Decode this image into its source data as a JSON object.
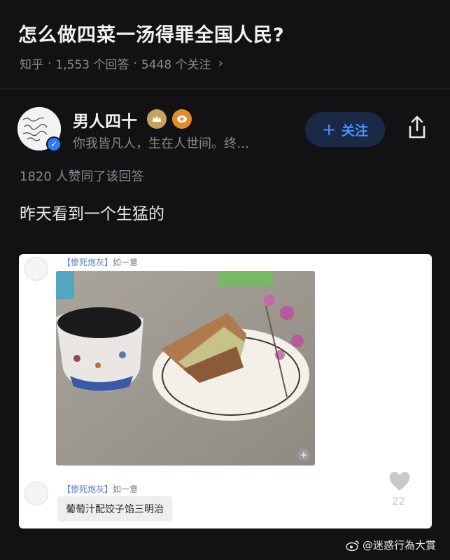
{
  "question": {
    "title": "怎么做四菜一汤得罪全国人民?",
    "source": "知乎",
    "answers_count": "1,553 个回答",
    "followers_count": "5448 个关注",
    "separator": "·",
    "chevron": "›"
  },
  "author": {
    "name": "男人四十",
    "bio": "你我皆凡人，生在人世间。终…",
    "follow_label": "关注",
    "follow_plus": "+",
    "verified_mark": "✓"
  },
  "answer": {
    "likes_text": "1820 人赞同了该回答",
    "text": "昨天看到一个生猛的"
  },
  "embedded_post": {
    "user_bracket": "【惨死炮灰】",
    "user_name": "如一意",
    "reply_user_bracket": "【惨死炮灰】",
    "reply_user_name": "如一意",
    "reply_text": "葡萄汁配饺子馅三明治",
    "heart_count": "22",
    "zoom_symbol": "+"
  },
  "watermark": {
    "text": "@迷惑行為大賞"
  },
  "colors": {
    "background": "#121214",
    "accent": "#4a90ff",
    "follow_bg": "#1a2a46",
    "muted_text": "#8a8a8e"
  }
}
